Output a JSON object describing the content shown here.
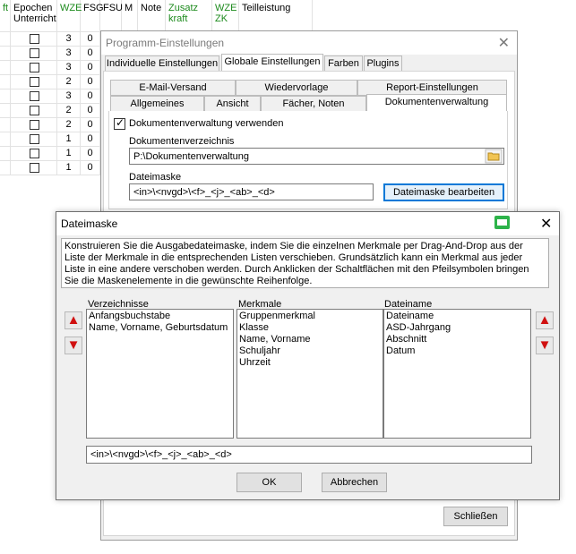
{
  "grid": {
    "headers": [
      {
        "text": "ft",
        "green": true
      },
      {
        "text": "Epochen\nUnterricht",
        "green": false
      },
      {
        "text": "WZE",
        "green": true
      },
      {
        "text": "FSG",
        "green": false
      },
      {
        "text": "FSU",
        "green": false
      },
      {
        "text": "M",
        "green": false
      },
      {
        "text": "Note",
        "green": false
      },
      {
        "text": "Zusatz\nkraft",
        "green": true
      },
      {
        "text": "WZE\nZK",
        "green": true
      },
      {
        "text": "Teilleistung",
        "green": false
      }
    ],
    "rows": [
      {
        "wze": "3",
        "fsg": "0"
      },
      {
        "wze": "3",
        "fsg": "0"
      },
      {
        "wze": "3",
        "fsg": "0"
      },
      {
        "wze": "2",
        "fsg": "0"
      },
      {
        "wze": "3",
        "fsg": "0"
      },
      {
        "wze": "2",
        "fsg": "0"
      },
      {
        "wze": "2",
        "fsg": "0"
      },
      {
        "wze": "1",
        "fsg": "0"
      },
      {
        "wze": "1",
        "fsg": "0"
      },
      {
        "wze": "1",
        "fsg": "0"
      }
    ]
  },
  "program_window": {
    "title": "Programm-Einstellungen",
    "close_glyph": "✕",
    "main_tabs": [
      "Individuelle Einstellungen",
      "Globale Einstellungen",
      "Farben",
      "Plugins"
    ],
    "sub_tabs_row1": [
      "E-Mail-Versand",
      "Wiedervorlage",
      "Report-Einstellungen"
    ],
    "sub_tabs_row2": [
      "Allgemeines",
      "Ansicht",
      "Fächer, Noten",
      "Dokumentenverwaltung"
    ],
    "checkbox_label": "Dokumentenverwaltung verwenden",
    "dir_label": "Dokumentenverzeichnis",
    "dir_value": "P:\\Dokumentenverwaltung",
    "mask_label": "Dateimaske",
    "mask_value": "<in>\\<nvgd>\\<f>_<j>_<ab>_<d>",
    "edit_mask_button": "Dateimaske bearbeiten",
    "close_button": "Schließen"
  },
  "dialog": {
    "title": "Dateimaske",
    "close_glyph": "✕",
    "description": "Konstruieren Sie die Ausgabedateimaske, indem Sie die einzelnen Merkmale per Drag-And-Drop aus der Liste der Merkmale in die entsprechenden Listen verschieben. Grundsätzlich kann ein Merkmal aus jeder Liste in eine andere verschoben werden. Durch Anklicken der Schaltflächen mit den Pfeilsymbolen bringen Sie die Maskenelemente in die gewünschte Reihenfolge.",
    "verzeichnisse_label": "Verzeichnisse",
    "verzeichnisse_items": [
      "Anfangsbuchstabe",
      "Name, Vorname, Geburtsdatum"
    ],
    "merkmale_label": "Merkmale",
    "merkmale_items": [
      "Gruppenmerkmal",
      "Klasse",
      "Name, Vorname",
      "Schuljahr",
      "Uhrzeit"
    ],
    "dateiname_label": "Dateiname",
    "dateiname_items": [
      "Dateiname",
      "ASD-Jahrgang",
      "Abschnitt",
      "Datum"
    ],
    "mask_value": "<in>\\<nvgd>\\<f>_<j>_<ab>_<d>",
    "ok_button": "OK",
    "cancel_button": "Abbrechen",
    "arrow_up": "▲",
    "arrow_down": "▼"
  },
  "colors": {
    "accent": "#0078d7",
    "green_header": "#1c8a1c",
    "arrow_red": "#d01010"
  }
}
